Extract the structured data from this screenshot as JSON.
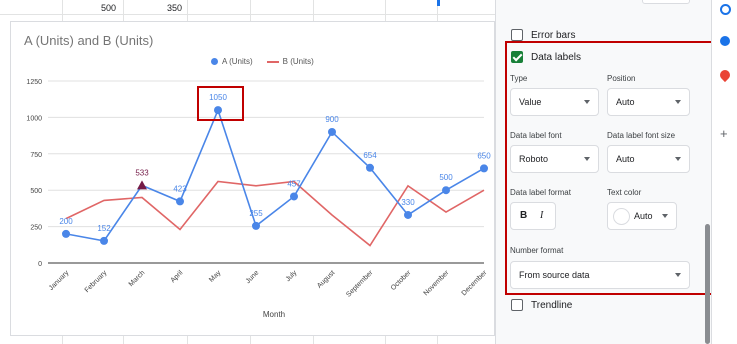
{
  "sheet": {
    "cells": [
      "500",
      "350"
    ]
  },
  "chart_data": {
    "type": "line",
    "title": "A (Units) and B (Units)",
    "xlabel": "Month",
    "ylabel": "",
    "categories": [
      "January",
      "February",
      "March",
      "April",
      "May",
      "June",
      "July",
      "August",
      "September",
      "October",
      "November",
      "December"
    ],
    "yticks": [
      "0",
      "250",
      "500",
      "750",
      "1000",
      "1250"
    ],
    "ylim": [
      0,
      1250
    ],
    "series": [
      {
        "name": "A (Units)",
        "color": "#4a86e8",
        "marker": "circle",
        "values": [
          200,
          152,
          533,
          423,
          1050,
          255,
          457,
          900,
          654,
          330,
          500,
          650
        ],
        "labels": [
          "200",
          "152",
          "533",
          "423",
          "1050",
          "255",
          "457",
          "900",
          "654",
          "330",
          "500",
          "650"
        ]
      },
      {
        "name": "B (Units)",
        "color": "#e06666",
        "marker": "none",
        "values": [
          305,
          430,
          450,
          230,
          560,
          530,
          560,
          330,
          120,
          530,
          350,
          500
        ]
      }
    ],
    "legend": "top",
    "grid": true
  },
  "panel": {
    "error_bars": "Error bars",
    "data_labels": "Data labels",
    "type_label": "Type",
    "type_value": "Value",
    "position_label": "Position",
    "position_value": "Auto",
    "font_label": "Data label font",
    "font_value": "Roboto",
    "font_size_label": "Data label font size",
    "font_size_value": "Auto",
    "format_label": "Data label format",
    "bold": "B",
    "italic": "I",
    "text_color_label": "Text color",
    "text_color_value": "Auto",
    "number_format_label": "Number format",
    "number_format_value": "From source data",
    "trendline": "Trendline"
  }
}
